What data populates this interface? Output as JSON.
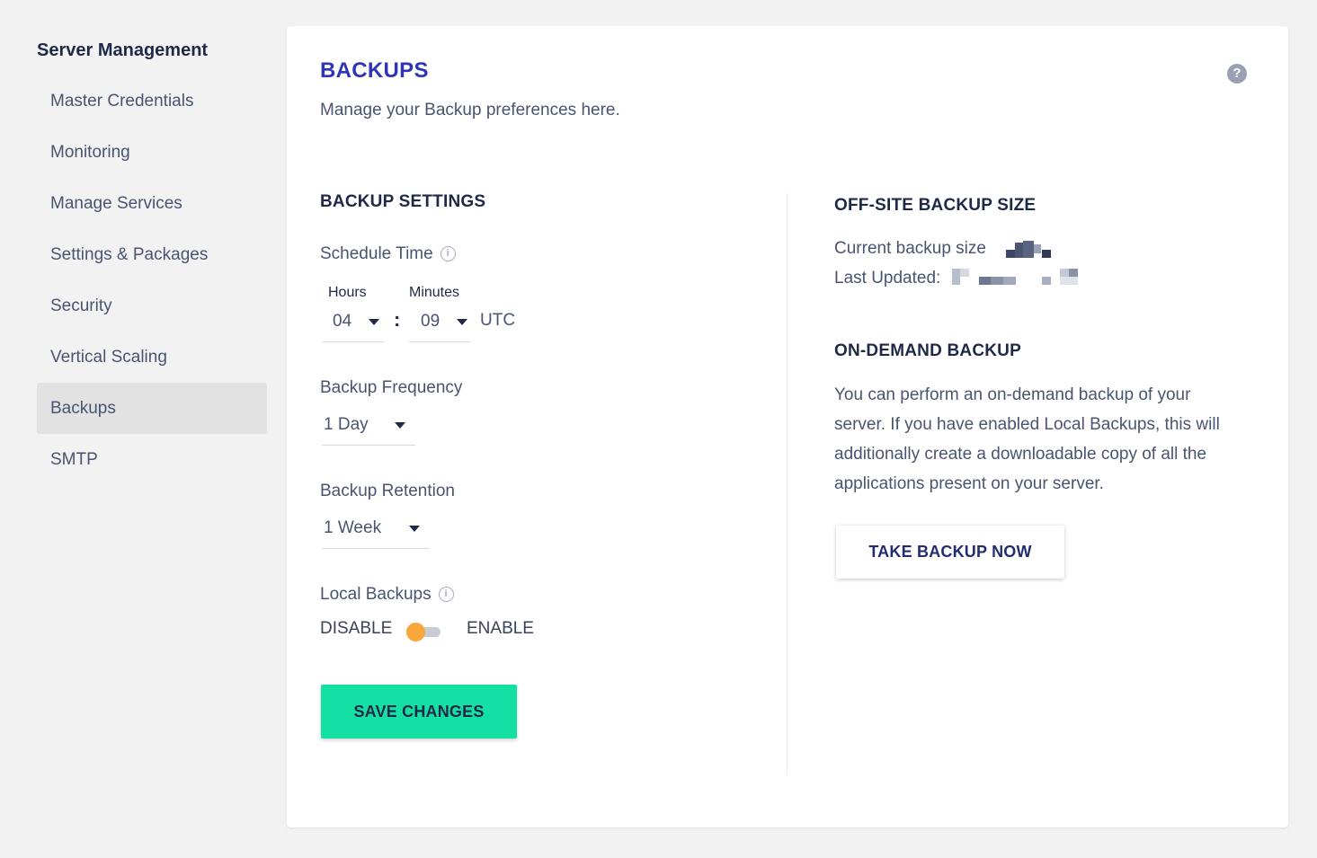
{
  "sidebar": {
    "title": "Server Management",
    "items": [
      {
        "label": "Master Credentials",
        "active": false
      },
      {
        "label": "Monitoring",
        "active": false
      },
      {
        "label": "Manage Services",
        "active": false
      },
      {
        "label": "Settings & Packages",
        "active": false
      },
      {
        "label": "Security",
        "active": false
      },
      {
        "label": "Vertical Scaling",
        "active": false
      },
      {
        "label": "Backups",
        "active": true
      },
      {
        "label": "SMTP",
        "active": false
      }
    ]
  },
  "header": {
    "title": "BACKUPS",
    "subtitle": "Manage your Backup preferences here.",
    "help_icon": "question-circle-icon",
    "help_symbol": "?"
  },
  "backup_settings": {
    "heading": "BACKUP SETTINGS",
    "schedule_time": {
      "label": "Schedule Time",
      "info_symbol": "i",
      "hours_label": "Hours",
      "hours_value": "04",
      "separator": ":",
      "minutes_label": "Minutes",
      "minutes_value": "09",
      "timezone": "UTC"
    },
    "frequency": {
      "label": "Backup Frequency",
      "value": "1 Day"
    },
    "retention": {
      "label": "Backup Retention",
      "value": "1 Week"
    },
    "local_backups": {
      "label": "Local Backups",
      "info_symbol": "i",
      "off_label": "DISABLE",
      "on_label": "ENABLE",
      "enabled": false
    },
    "save_label": "SAVE CHANGES"
  },
  "offsite": {
    "heading": "OFF-SITE BACKUP SIZE",
    "size_label": "Current backup size",
    "updated_label": "Last Updated:"
  },
  "on_demand": {
    "heading": "ON-DEMAND BACKUP",
    "lines": [
      "You can perform an on-demand backup of your",
      "server. If you have enabled Local Backups, this will",
      "additionally create a downloadable copy of all the",
      "applications present on your server."
    ],
    "button_label": "TAKE BACKUP NOW"
  },
  "colors": {
    "accent_title": "#2f35b7",
    "save_button": "#15e0a4",
    "toggle_knob": "#f9a63b",
    "active_sidebar": "#e2e2e2"
  }
}
